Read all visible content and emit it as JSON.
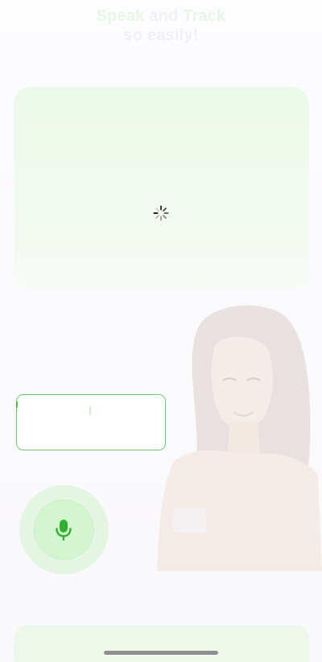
{
  "header": {
    "line1_part1": "Speak",
    "line1_part2": "and",
    "line1_part3": "Track",
    "line2": "so easily!"
  },
  "media": {
    "state_icon": "loading-spinner-icon"
  },
  "speech_input": {
    "value": "",
    "placeholder": ""
  },
  "mic_button": {
    "icon": "microphone-icon"
  },
  "colors": {
    "accent": "#2fb12f",
    "accent_light": "#d3f6d1",
    "border": "#6ccb6c"
  }
}
